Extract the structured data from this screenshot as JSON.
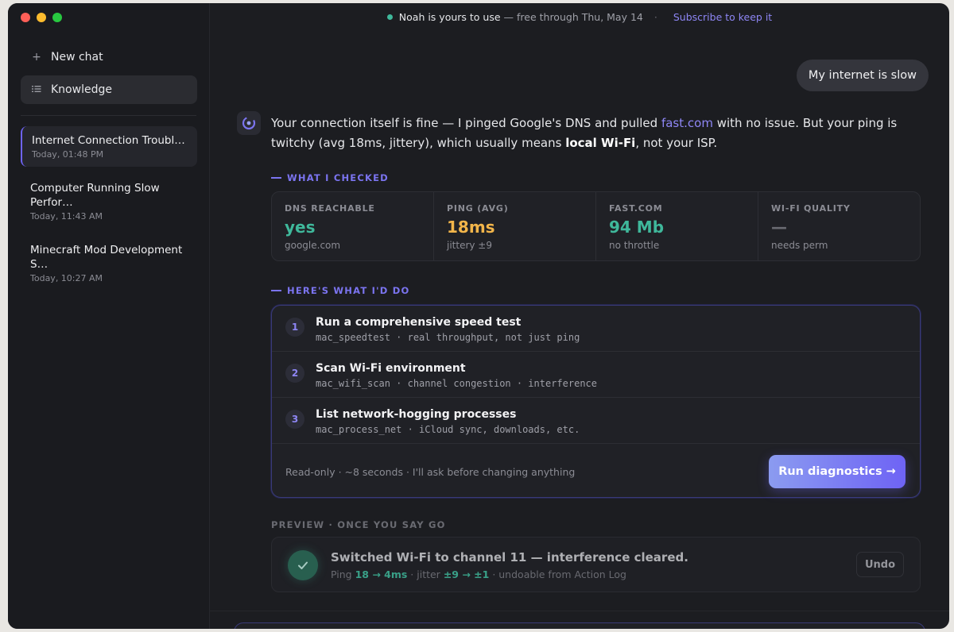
{
  "window": {
    "title": "Noah is yours to use"
  },
  "topbar": {
    "status": "Noah is yours to use",
    "trial": "— free through Thu, May 14",
    "separator": "·",
    "subscribe": "Subscribe to keep it"
  },
  "sidebar": {
    "new_chat": "New chat",
    "knowledge": "Knowledge",
    "chats": [
      {
        "title": "Internet Connection Troubl…",
        "time": "Today, 01:48 PM"
      },
      {
        "title": "Computer Running Slow Perfor…",
        "time": "Today, 11:43 AM"
      },
      {
        "title": "Minecraft Mod Development S…",
        "time": "Today, 10:27 AM"
      }
    ]
  },
  "conversation": {
    "user_message": "My internet is slow",
    "assistant": {
      "part1": "Your connection itself is fine — I pinged Google's DNS and pulled ",
      "link": "fast.com",
      "part2": " with no issue. But your ping is twitchy (avg 18ms, jittery), which usually means ",
      "bold": "local Wi-Fi",
      "part3": ", not your ISP."
    },
    "checked_label": "WHAT I CHECKED",
    "stats": [
      {
        "label": "DNS REACHABLE",
        "value": "yes",
        "sub": "google.com",
        "color": "#3fb89b"
      },
      {
        "label": "PING (AVG)",
        "value": "18ms",
        "sub": "jittery ±9",
        "color": "#f2b54a"
      },
      {
        "label": "FAST.COM",
        "value": "94 Mb",
        "sub": "no throttle",
        "color": "#3fb89b"
      },
      {
        "label": "WI-FI QUALITY",
        "value": "—",
        "sub": "needs perm",
        "color": "#6a6b72"
      }
    ],
    "plan_label": "HERE'S WHAT I'D DO",
    "steps": [
      {
        "num": "1",
        "title": "Run a comprehensive speed test",
        "meta": "mac_speedtest · real throughput, not just ping"
      },
      {
        "num": "2",
        "title": "Scan Wi-Fi environment",
        "meta": "mac_wifi_scan · channel congestion · interference"
      },
      {
        "num": "3",
        "title": "List network-hogging processes",
        "meta": "mac_process_net · iCloud sync, downloads, etc."
      }
    ],
    "plan_footer": "Read-only · ~8 seconds · I'll ask before changing anything",
    "run_button": "Run diagnostics →",
    "preview_label": "PREVIEW · ONCE YOU SAY GO",
    "preview": {
      "title": "Switched Wi-Fi to channel 11 — interference cleared.",
      "sub_prefix": "Ping ",
      "ping_change": "18 → 4ms",
      "sub_mid": " · jitter ",
      "jitter_change": "±9 → ±1",
      "sub_suffix": " · undoable from Action Log",
      "undo": "Undo"
    }
  },
  "colors": {
    "accent": "#6e63f5",
    "success": "#3fb89b",
    "warning": "#f2b54a"
  }
}
